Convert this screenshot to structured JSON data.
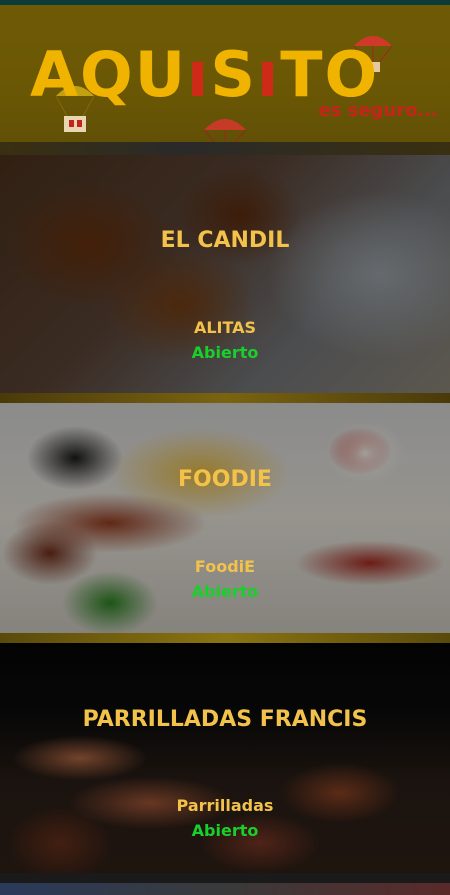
{
  "brand": {
    "logo_text_1": "AQU",
    "logo_i1": "ı",
    "logo_s": "S",
    "logo_i2": "ı",
    "logo_text_2": "TO",
    "tagline": "es seguro..."
  },
  "restaurants": [
    {
      "name": "EL CANDIL",
      "category": "ALITAS",
      "status": "Abierto"
    },
    {
      "name": "FOODIE",
      "category": "FoodiE",
      "status": "Abierto"
    },
    {
      "name": "PARRILLADAS FRANCIS",
      "category": "Parrilladas",
      "status": "Abierto"
    }
  ],
  "colors": {
    "brand_yellow": "#f0b300",
    "brand_red": "#cf2a18",
    "title_text": "#f3c24a",
    "status_open": "#19d02b",
    "header_bg": "#6f5b06"
  }
}
